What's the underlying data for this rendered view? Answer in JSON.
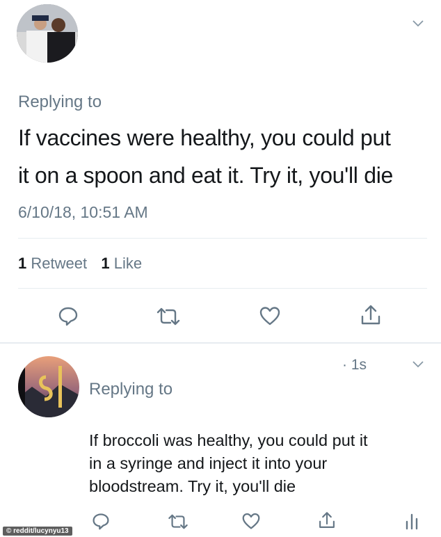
{
  "tweet1": {
    "replying_to": "Replying to",
    "text_line1": "If vaccines were healthy, you could put",
    "text_line2": "it on a spoon and eat it. Try it, you'll die",
    "timestamp": "6/10/18, 10:51 AM",
    "retweet_count": "1",
    "retweet_label": "Retweet",
    "like_count": "1",
    "like_label": "Like",
    "icons": [
      "reply-icon",
      "retweet-icon",
      "like-icon",
      "share-icon"
    ]
  },
  "tweet2": {
    "time": "· 1s",
    "replying_to": "Replying to",
    "text_line1": "If broccoli was healthy, you could put it",
    "text_line2": "in a syringe and inject it into your",
    "text_line3": "bloodstream. Try it, you'll die",
    "icons": [
      "reply-icon",
      "retweet-icon",
      "like-icon",
      "share-icon",
      "analytics-icon"
    ]
  },
  "watermark": "© reddit/lucynyu13",
  "colors": {
    "text": "#14171a",
    "muted": "#657786",
    "divider": "#e6ecf0",
    "icon": "#657786"
  }
}
